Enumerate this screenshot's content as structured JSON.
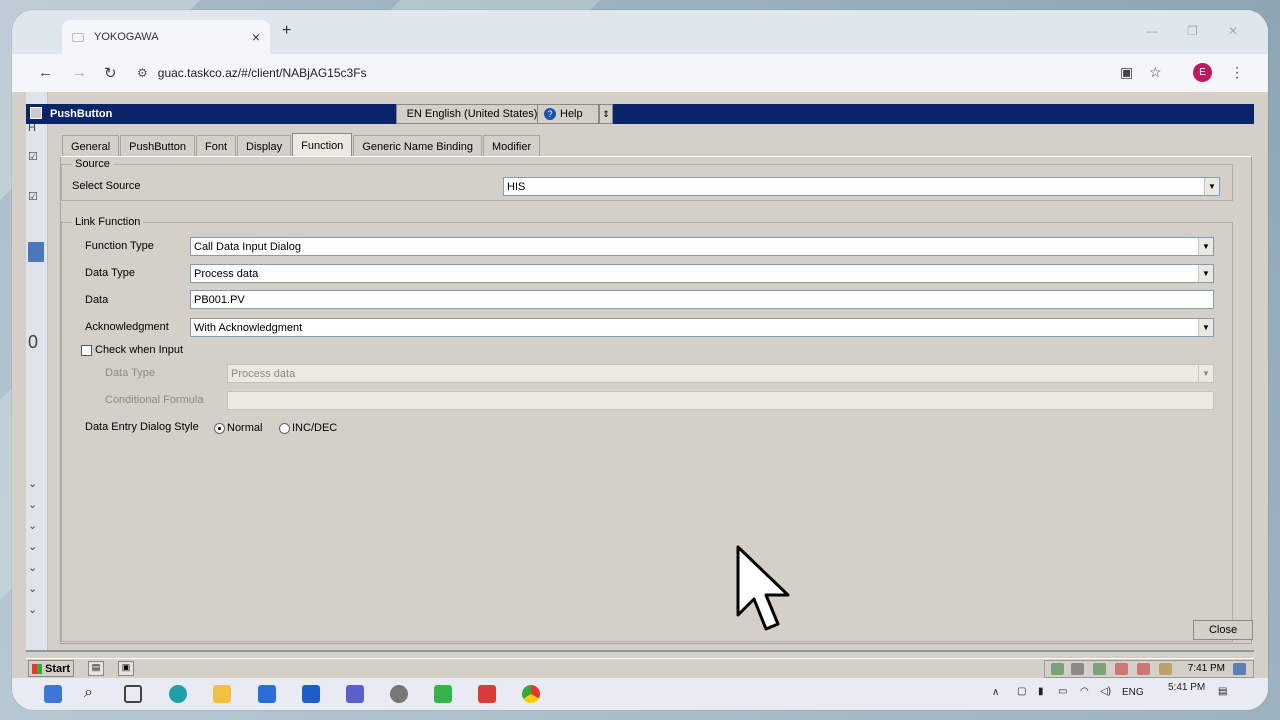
{
  "browser": {
    "tab_title": "YOKOGAWA",
    "tab_close": "×",
    "new_tab": "+",
    "url": "guac.taskco.az/#/client/NABjAG15c3Fs",
    "profile_initial": "E"
  },
  "dialog": {
    "title": "PushButton",
    "language": "EN English (United States)",
    "help_label": "Help",
    "tabs": [
      "General",
      "PushButton",
      "Font",
      "Display",
      "Function",
      "Generic Name Binding",
      "Modifier"
    ],
    "active_tab": "Function",
    "source": {
      "group_label": "Source",
      "select_source_label": "Select Source",
      "select_source_value": "HIS"
    },
    "link_function": {
      "group_label": "Link Function",
      "function_type_label": "Function Type",
      "function_type_value": "Call Data Input Dialog",
      "data_type_label": "Data Type",
      "data_type_value": "Process data",
      "data_label": "Data",
      "data_value": "PB001.PV",
      "ack_label": "Acknowledgment",
      "ack_value": "With Acknowledgment",
      "check_when_input_label": "Check when Input",
      "check_when_input_checked": false,
      "cw_data_type_label": "Data Type",
      "cw_data_type_value": "Process data",
      "conditional_formula_label": "Conditional Formula",
      "conditional_formula_value": "",
      "entry_style_label": "Data Entry Dialog Style",
      "entry_style_options": [
        "Normal",
        "INC/DEC"
      ],
      "entry_style_selected": "Normal"
    },
    "close_label": "Close"
  },
  "xp_taskbar": {
    "start_label": "Start",
    "clock": "7:41 PM"
  },
  "win_taskbar": {
    "lang": "ENG",
    "time": "5:41 PM"
  }
}
